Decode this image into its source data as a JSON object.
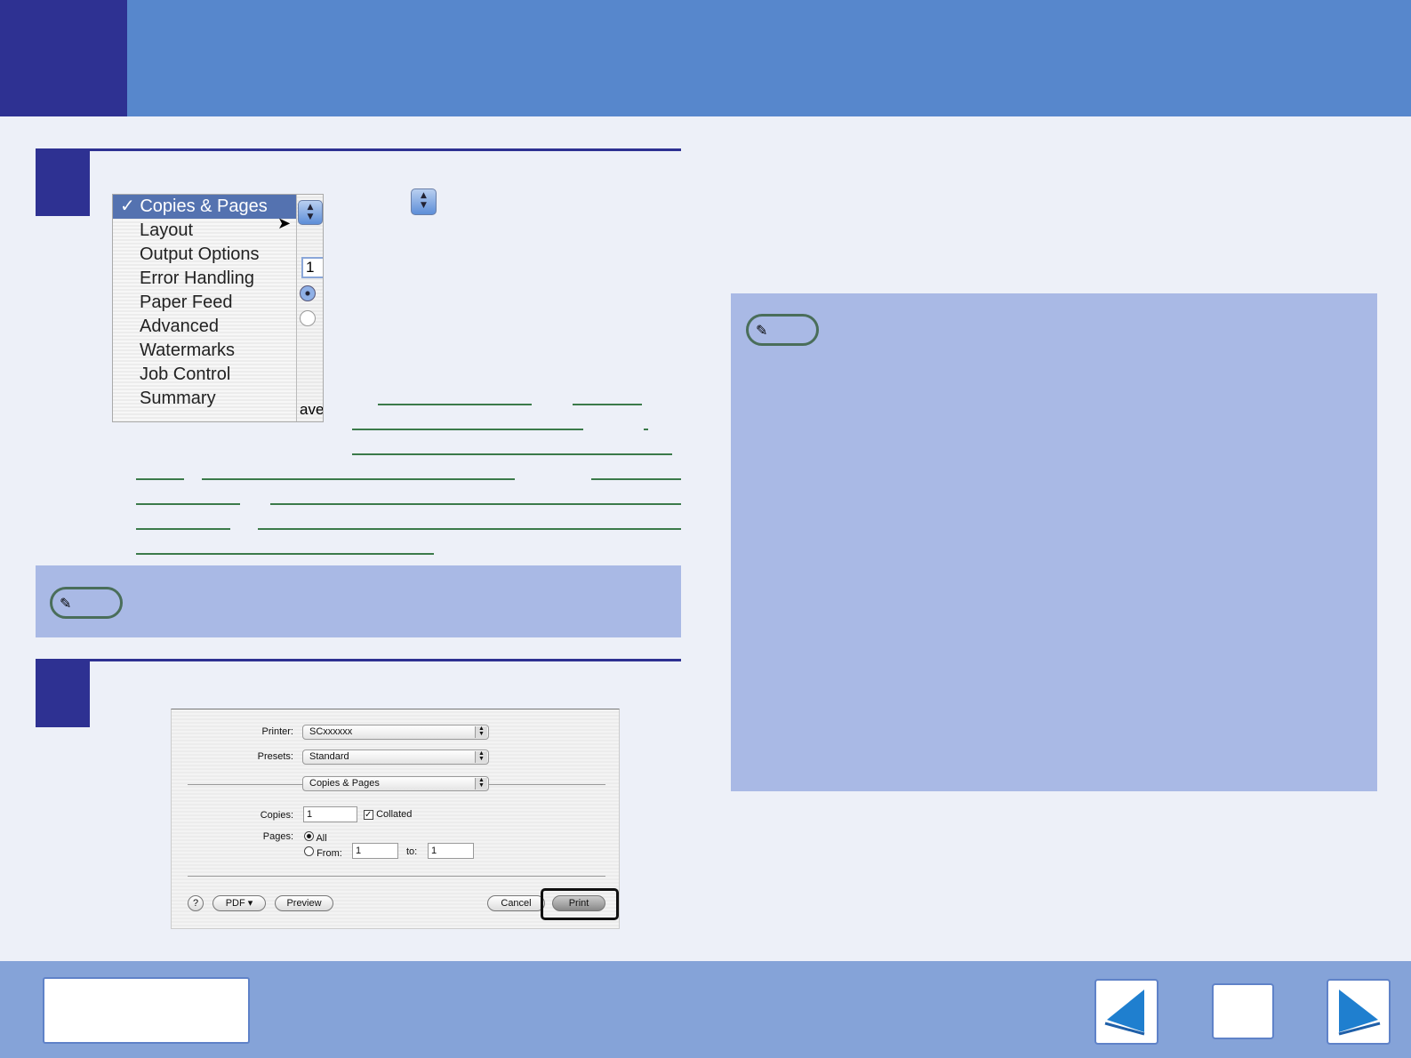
{
  "step1_menu": {
    "items": [
      "Copies & Pages",
      "Layout",
      "Output Options",
      "Error Handling",
      "Paper Feed",
      "Advanced",
      "Watermarks",
      "Job Control",
      "Summary"
    ],
    "checked": "Copies & Pages",
    "behind_values": {
      "copies": "1",
      "partial_button": "ave"
    }
  },
  "print_dialog": {
    "printer_label": "Printer:",
    "printer_value": "SCxxxxxx",
    "presets_label": "Presets:",
    "presets_value": "Standard",
    "panel_value": "Copies & Pages",
    "copies_label": "Copies:",
    "copies_value": "1",
    "collated_label": "Collated",
    "pages_label": "Pages:",
    "all_label": "All",
    "from_label": "From:",
    "from_value": "1",
    "to_label": "to:",
    "to_value": "1",
    "help_label": "?",
    "pdf_label": "PDF ▾",
    "preview_label": "Preview",
    "cancel_label": "Cancel",
    "print_label": "Print"
  },
  "colors": {
    "header": "#5787cc",
    "accent": "#2e3192",
    "note": "#a9b9e5",
    "footer": "#85a3d8"
  }
}
